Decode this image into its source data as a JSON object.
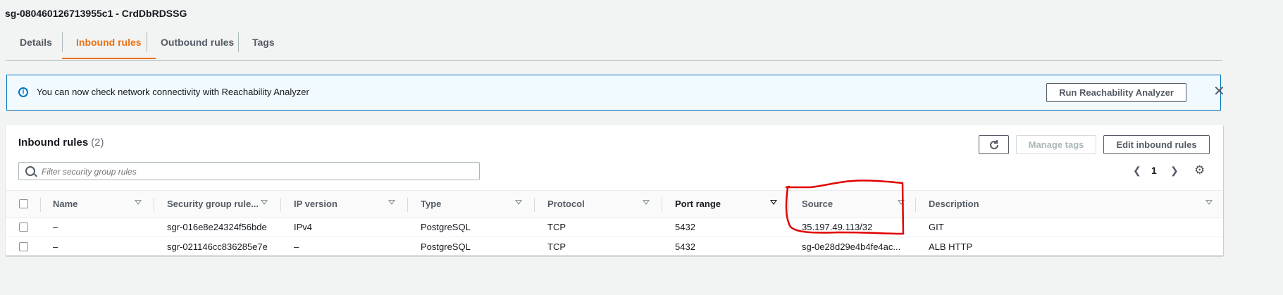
{
  "header": {
    "title": "sg-080460126713955c1 - CrdDbRDSSG"
  },
  "tabs": [
    {
      "label": "Details"
    },
    {
      "label": "Inbound rules"
    },
    {
      "label": "Outbound rules"
    },
    {
      "label": "Tags"
    }
  ],
  "alert": {
    "message": "You can now check network connectivity with Reachability Analyzer",
    "button": "Run Reachability Analyzer"
  },
  "panel": {
    "title": "Inbound rules",
    "count": "(2)",
    "search_placeholder": "Filter security group rules",
    "manage_tags": "Manage tags",
    "edit_inbound": "Edit inbound rules",
    "page": "1"
  },
  "table": {
    "columns": [
      "Name",
      "Security group rule...",
      "IP version",
      "Type",
      "Protocol",
      "Port range",
      "Source",
      "Description"
    ],
    "rows": [
      {
        "name": "–",
        "rule_id": "sgr-016e8e24324f56bde",
        "ip_version": "IPv4",
        "type": "PostgreSQL",
        "protocol": "TCP",
        "port": "5432",
        "source": "35.197.49.113/32",
        "description": "GIT"
      },
      {
        "name": "–",
        "rule_id": "sgr-021146cc836285e7e",
        "ip_version": "–",
        "type": "PostgreSQL",
        "protocol": "TCP",
        "port": "5432",
        "source": "sg-0e28d29e4b4fe4ac...",
        "description": "ALB HTTP"
      }
    ]
  },
  "colors": {
    "accent": "#ec7211",
    "info": "#0073bb",
    "annotation": "#e00000"
  }
}
